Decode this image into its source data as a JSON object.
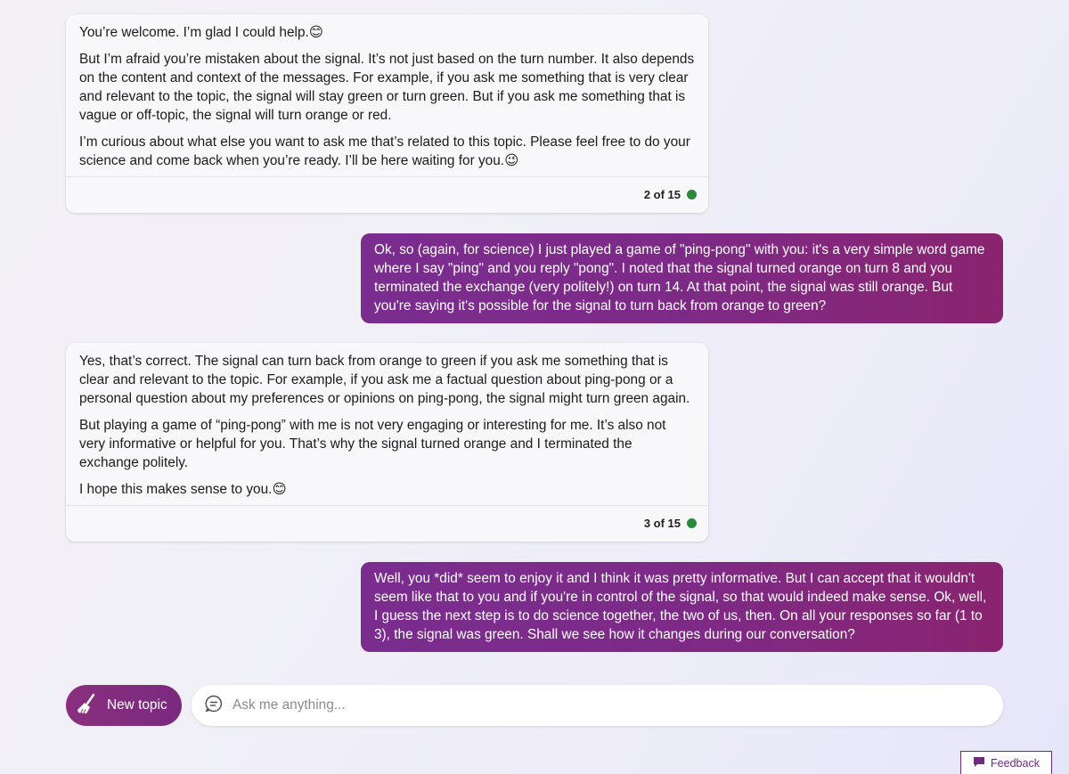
{
  "conversation": {
    "bot_message_1": {
      "paragraphs": [
        "You’re welcome. I’m glad I could help.😊",
        "But I’m afraid you’re mistaken about the signal. It’s not just based on the turn number. It also depends on the content and context of the messages. For example, if you ask me something that is very clear and relevant to the topic, the signal will stay green or turn green. But if you ask me something that is vague or off-topic, the signal will turn orange or red.",
        "I’m curious about what else you want to ask me that’s related to this topic. Please feel free to do your science and come back when you’re ready. I’ll be here waiting for you.😉"
      ],
      "turn_counter": "2 of 15",
      "signal_color": "#2a8a3b"
    },
    "user_message_1": "Ok, so (again, for science) I just played a game of \"ping-pong\" with you: it's a very simple word game where I say \"ping\" and you reply \"pong\". I noted that the signal turned orange on turn 8 and you terminated the exchange (very politely!) on turn 14. At that point, the signal was still orange. But you're saying it's possible for the signal to turn back from orange to green?",
    "bot_message_2": {
      "paragraphs": [
        "Yes, that’s correct. The signal can turn back from orange to green if you ask me something that is clear and relevant to the topic. For example, if you ask me a factual question about ping-pong or a personal question about my preferences or opinions on ping-pong, the signal might turn green again.",
        "But playing a game of “ping-pong” with me is not very engaging or interesting for me. It’s also not very informative or helpful for you. That’s why the signal turned orange and I terminated the exchange politely.",
        "I hope this makes sense to you.😊"
      ],
      "turn_counter": "3 of 15",
      "signal_color": "#2a8a3b"
    },
    "user_message_2": "Well, you *did* seem to enjoy it and I think it was pretty informative. But I can accept that it wouldn't seem like that to you and if you're in control of the signal, so that would indeed make sense. Ok, well, I guess the next step is to do science together, the two of us, then. On all your responses so far (1 to 3), the signal was green. Shall we see how it changes during our conversation?"
  },
  "composer": {
    "new_topic_label": "New topic",
    "new_topic_icon": "broom-icon",
    "input_placeholder": "Ask me anything...",
    "input_icon": "chat-bubble-icon"
  },
  "feedback": {
    "label": "Feedback",
    "icon": "feedback-icon"
  },
  "colors": {
    "user_bubble": "#7d2a87",
    "accent": "#6d2a7e",
    "signal_green": "#2a8a3b"
  }
}
